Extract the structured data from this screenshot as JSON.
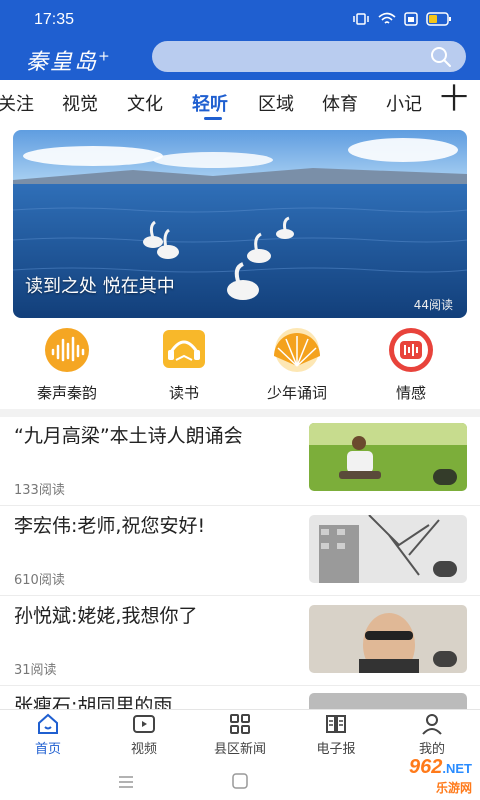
{
  "status": {
    "time": "17:35"
  },
  "header": {
    "logo": "秦皇岛",
    "logo_plus": "+",
    "search_placeholder": ""
  },
  "tabs": [
    {
      "label": "关注"
    },
    {
      "label": "视觉"
    },
    {
      "label": "文化"
    },
    {
      "label": "轻听",
      "active": true
    },
    {
      "label": "区域"
    },
    {
      "label": "体育"
    },
    {
      "label": "小记"
    }
  ],
  "tab_add": "十",
  "banner": {
    "title": "读到之处  悦在其中",
    "reads": "44阅读"
  },
  "quick": [
    {
      "label": "秦声秦韵",
      "icon": "sound-wave-icon"
    },
    {
      "label": "读书",
      "icon": "book-headphone-icon"
    },
    {
      "label": "少年诵词",
      "icon": "fan-icon"
    },
    {
      "label": "情感",
      "icon": "radio-icon"
    }
  ],
  "articles": [
    {
      "title": "“九月高梁”本土诗人朗诵会",
      "reads": "133阅读"
    },
    {
      "title": "李宏伟:老师,祝您安好!",
      "reads": "610阅读"
    },
    {
      "title": "孙悦斌:姥姥,我想你了",
      "reads": "31阅读"
    },
    {
      "title": "张瘦石:胡同里的雨",
      "reads": ""
    }
  ],
  "bottom_nav": [
    {
      "label": "首页",
      "icon": "home-icon",
      "active": true
    },
    {
      "label": "视频",
      "icon": "video-icon"
    },
    {
      "label": "县区新闻",
      "icon": "grid-icon"
    },
    {
      "label": "电子报",
      "icon": "newspaper-icon"
    },
    {
      "label": "我的",
      "icon": "profile-icon"
    }
  ],
  "watermark": {
    "number": "962",
    "suffix": ".NET",
    "sub": "乐游网"
  },
  "colors": {
    "brand": "#1f5fd0",
    "search_bg": "#b9ccef"
  }
}
